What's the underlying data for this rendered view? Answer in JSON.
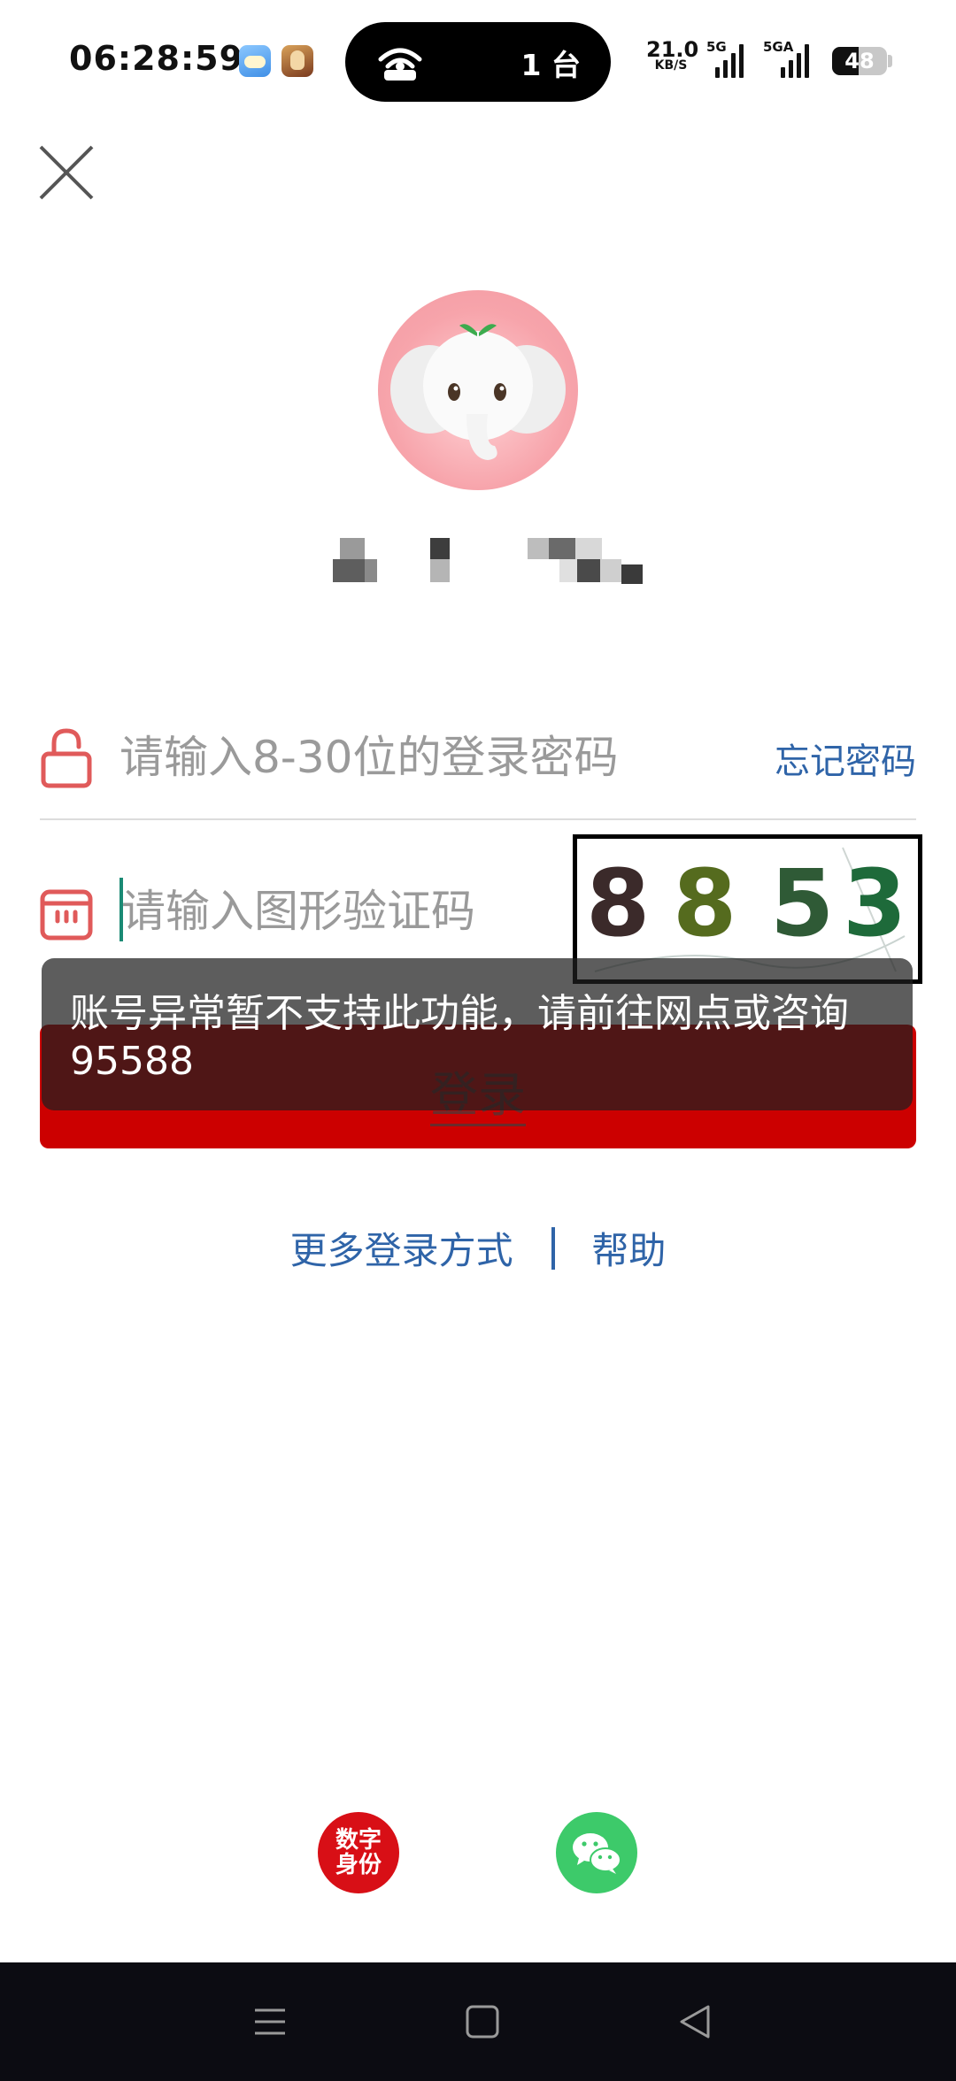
{
  "status_bar": {
    "time": "06:28:59",
    "hotspot_devices": "1 台",
    "net_speed_value": "21.0",
    "net_speed_unit": "KB/S",
    "signal1_label": "5G",
    "signal2_label": "5GA",
    "battery_percent": 48
  },
  "login": {
    "password_placeholder": "请输入8-30位的登录密码",
    "forgot_password": "忘记密码",
    "captcha_placeholder": "请输入图形验证码",
    "captcha_code": [
      "8",
      "8",
      "5",
      "3"
    ],
    "login_button": "登录",
    "toast_message": "账号异常暂不支持此功能，请前往网点或咨询95588",
    "more_login_methods": "更多登录方式",
    "help": "帮助"
  },
  "bottom_options": {
    "digital_id_line1": "数字",
    "digital_id_line2": "身份"
  },
  "colors": {
    "brand_red": "#cc0000",
    "link_blue": "#2f64a8",
    "wechat_green": "#3dca6a"
  },
  "icons": [
    "close-icon",
    "lock-icon",
    "captcha-icon",
    "wechat-icon",
    "hotspot-icon",
    "nav-menu-icon",
    "nav-home-icon",
    "nav-back-icon"
  ]
}
